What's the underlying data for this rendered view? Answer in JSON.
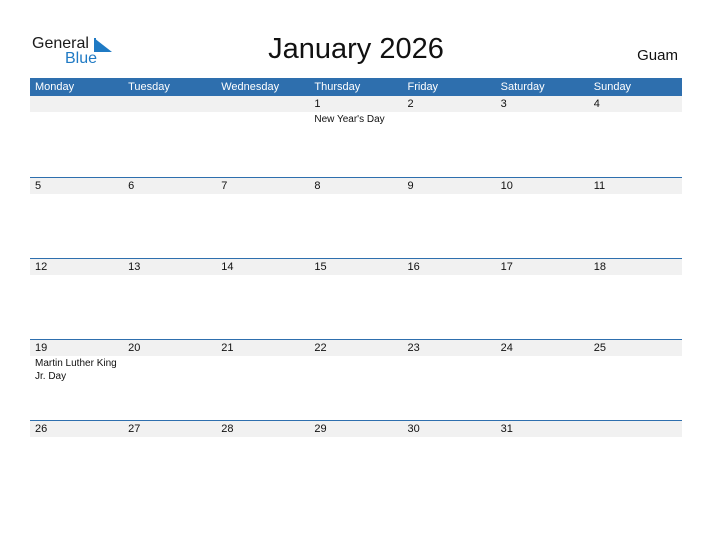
{
  "logo": {
    "general": "General",
    "blue": "Blue"
  },
  "title": "January 2026",
  "country": "Guam",
  "weekdays": [
    "Monday",
    "Tuesday",
    "Wednesday",
    "Thursday",
    "Friday",
    "Saturday",
    "Sunday"
  ],
  "weeks": [
    {
      "days": [
        "",
        "",
        "",
        "1",
        "2",
        "3",
        "4"
      ],
      "events": [
        "",
        "",
        "",
        "New Year's Day",
        "",
        "",
        ""
      ]
    },
    {
      "days": [
        "5",
        "6",
        "7",
        "8",
        "9",
        "10",
        "11"
      ],
      "events": [
        "",
        "",
        "",
        "",
        "",
        "",
        ""
      ]
    },
    {
      "days": [
        "12",
        "13",
        "14",
        "15",
        "16",
        "17",
        "18"
      ],
      "events": [
        "",
        "",
        "",
        "",
        "",
        "",
        ""
      ]
    },
    {
      "days": [
        "19",
        "20",
        "21",
        "22",
        "23",
        "24",
        "25"
      ],
      "events": [
        "Martin Luther King Jr. Day",
        "",
        "",
        "",
        "",
        "",
        ""
      ]
    },
    {
      "days": [
        "26",
        "27",
        "28",
        "29",
        "30",
        "31",
        ""
      ],
      "events": [
        "",
        "",
        "",
        "",
        "",
        "",
        ""
      ]
    }
  ]
}
